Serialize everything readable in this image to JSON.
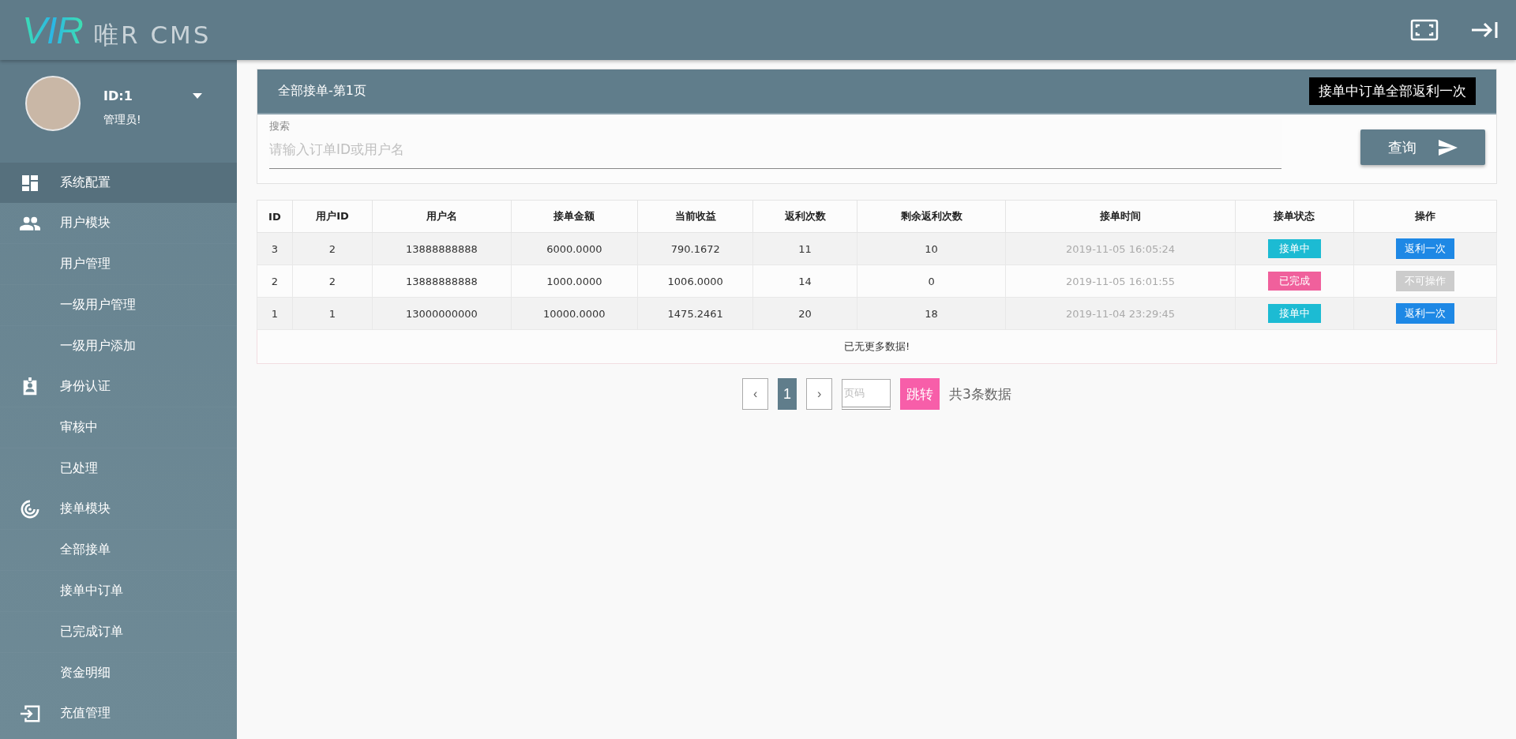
{
  "header": {
    "logo_mark": "VIR",
    "logo_text": "唯R CMS"
  },
  "profile": {
    "id": "ID:1",
    "role": "管理员!"
  },
  "menu": [
    {
      "label": "系统配置",
      "selected": true
    },
    {
      "label": "用户模块",
      "selected": false,
      "children": [
        {
          "label": "用户管理"
        },
        {
          "label": "一级用户管理"
        },
        {
          "label": "一级用户添加"
        }
      ]
    },
    {
      "label": "身份认证",
      "selected": false,
      "children": [
        {
          "label": "审核中"
        },
        {
          "label": "已处理"
        }
      ]
    },
    {
      "label": "接单模块",
      "selected": false,
      "children": [
        {
          "label": "全部接单"
        },
        {
          "label": "接单中订单"
        },
        {
          "label": "已完成订单"
        },
        {
          "label": "资金明细"
        }
      ]
    },
    {
      "label": "充值管理",
      "selected": false
    }
  ],
  "panel": {
    "title": "全部接单-第1页",
    "action": "接单中订单全部返利一次",
    "search_label": "搜索",
    "search_placeholder": "请输入订单ID或用户名",
    "search_button": "查询"
  },
  "table": {
    "columns": [
      "ID",
      "用户ID",
      "用户名",
      "接单金额",
      "当前收益",
      "返利次数",
      "剩余返利次数",
      "接单时间",
      "接单状态",
      "操作"
    ],
    "rows": [
      {
        "cells": [
          "3",
          "2",
          "13888888888",
          "6000.0000",
          "790.1672",
          "11",
          "10",
          "2019-11-05 16:05:24"
        ],
        "status": {
          "label": "接单中",
          "color": "#1cbbd3"
        },
        "action": "返利一次",
        "disabled": false
      },
      {
        "cells": [
          "2",
          "2",
          "13888888888",
          "1000.0000",
          "1006.0000",
          "14",
          "0",
          "2019-11-05 16:01:55"
        ],
        "status": {
          "label": "已完成",
          "color": "#f0609c"
        },
        "action": "不可操作",
        "disabled": true
      },
      {
        "cells": [
          "1",
          "1",
          "13000000000",
          "10000.0000",
          "1475.2461",
          "20",
          "18",
          "2019-11-04 23:29:45"
        ],
        "status": {
          "label": "接单中",
          "color": "#1cbbd3"
        },
        "action": "返利一次",
        "disabled": false
      }
    ],
    "footer": "已无更多数据!"
  },
  "pagination": {
    "prev": "‹",
    "pages": [
      {
        "label": "1",
        "selected": true
      }
    ],
    "next": "›",
    "page_placeholder": "页码",
    "jump": "跳转",
    "total": "共3条数据"
  }
}
